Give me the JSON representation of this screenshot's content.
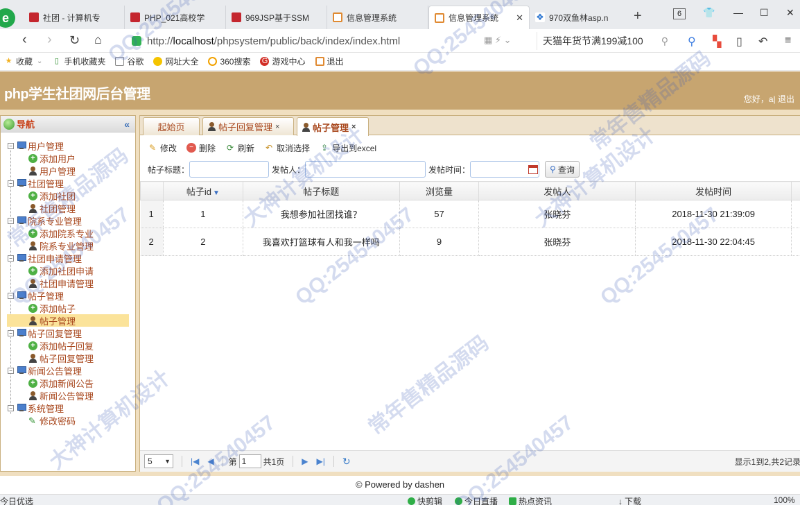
{
  "browser": {
    "logo": "e",
    "tabs": [
      {
        "label": "社团 - 计算机专",
        "icon": "red-favicon"
      },
      {
        "label": "PHP_021高校学",
        "icon": "red-favicon"
      },
      {
        "label": "969JSP基于SSM",
        "icon": "red-favicon"
      },
      {
        "label": "信息管理系统",
        "icon": "orange-favicon"
      },
      {
        "label": "信息管理系统",
        "icon": "orange-favicon",
        "active": true
      },
      {
        "label": "970双鱼林asp.n",
        "icon": "paw-favicon"
      }
    ],
    "tab_count": "6",
    "url_prefix": "http://",
    "url_host": "localhost",
    "url_path": "/phpsystem/public/back/index/index.html",
    "search_text": "天猫年货节满199减100"
  },
  "bookmarks": [
    {
      "label": "收藏",
      "icon": "star-icon"
    },
    {
      "label": "手机收藏夹",
      "icon": "phone-icon"
    },
    {
      "label": "谷歌",
      "icon": "page-icon"
    },
    {
      "label": "网址大全",
      "icon": "compass-icon"
    },
    {
      "label": "360搜索",
      "icon": "search-360-icon"
    },
    {
      "label": "游戏中心",
      "icon": "game-icon"
    },
    {
      "label": "退出",
      "icon": "exit-icon"
    }
  ],
  "app": {
    "title": "php学生社团网后台管理",
    "greeting": "您好，a|",
    "logout": "退出"
  },
  "sidebar": {
    "title": "导航",
    "groups": [
      {
        "label": "用户管理",
        "items": [
          {
            "label": "添加用户",
            "icon": "add"
          },
          {
            "label": "用户管理",
            "icon": "user"
          }
        ]
      },
      {
        "label": "社团管理",
        "items": [
          {
            "label": "添加社团",
            "icon": "add"
          },
          {
            "label": "社团管理",
            "icon": "user"
          }
        ]
      },
      {
        "label": "院系专业管理",
        "items": [
          {
            "label": "添加院系专业",
            "icon": "add"
          },
          {
            "label": "院系专业管理",
            "icon": "user"
          }
        ]
      },
      {
        "label": "社团申请管理",
        "items": [
          {
            "label": "添加社团申请",
            "icon": "add"
          },
          {
            "label": "社团申请管理",
            "icon": "user"
          }
        ]
      },
      {
        "label": "帖子管理",
        "items": [
          {
            "label": "添加帖子",
            "icon": "add"
          },
          {
            "label": "帖子管理",
            "icon": "user",
            "selected": true
          }
        ]
      },
      {
        "label": "帖子回复管理",
        "items": [
          {
            "label": "添加帖子回复",
            "icon": "add"
          },
          {
            "label": "帖子回复管理",
            "icon": "user"
          }
        ]
      },
      {
        "label": "新闻公告管理",
        "items": [
          {
            "label": "添加新闻公告",
            "icon": "add"
          },
          {
            "label": "新闻公告管理",
            "icon": "user"
          }
        ]
      },
      {
        "label": "系统管理",
        "items": [
          {
            "label": "修改密码",
            "icon": "pencil"
          }
        ]
      }
    ]
  },
  "content_tabs": [
    {
      "label": "起始页"
    },
    {
      "label": "帖子回复管理",
      "closable": true
    },
    {
      "label": "帖子管理",
      "closable": true,
      "active": true
    }
  ],
  "toolbar": {
    "edit": "修改",
    "delete": "删除",
    "refresh": "刷新",
    "cancel_select": "取消选择",
    "export": "导出到excel"
  },
  "filters": {
    "title_label": "帖子标题：",
    "title_value": "",
    "poster_label": "发帖人：",
    "poster_value": "",
    "time_label": "发帖时间：",
    "time_value": "",
    "query": "查询"
  },
  "grid": {
    "columns": [
      "帖子id",
      "帖子标题",
      "浏览量",
      "发帖人",
      "发帖时间"
    ],
    "sort_column": "帖子id",
    "rows": [
      {
        "rownum": "1",
        "id": "1",
        "title": "我想参加社团找谁？",
        "views": "57",
        "poster": "张晓芬",
        "time": "2018-11-30 21:39:09"
      },
      {
        "rownum": "2",
        "id": "2",
        "title": "我喜欢打篮球有人和我一样吗",
        "views": "9",
        "poster": "张晓芬",
        "time": "2018-11-30 22:04:45"
      }
    ]
  },
  "pager": {
    "page_size": "5",
    "page_prefix": "第",
    "page_value": "1",
    "page_total": "共1页",
    "info": "显示1到2,共2记录"
  },
  "footer": "© Powered by dashen",
  "statusbar": {
    "left": "今日优选",
    "items": [
      "快剪辑",
      "今日直播",
      "热点资讯",
      "下载"
    ],
    "zoom": "100%"
  },
  "watermarks": [
    "QQ:254540457",
    "大神计算机设计",
    "常年售精品源码"
  ]
}
